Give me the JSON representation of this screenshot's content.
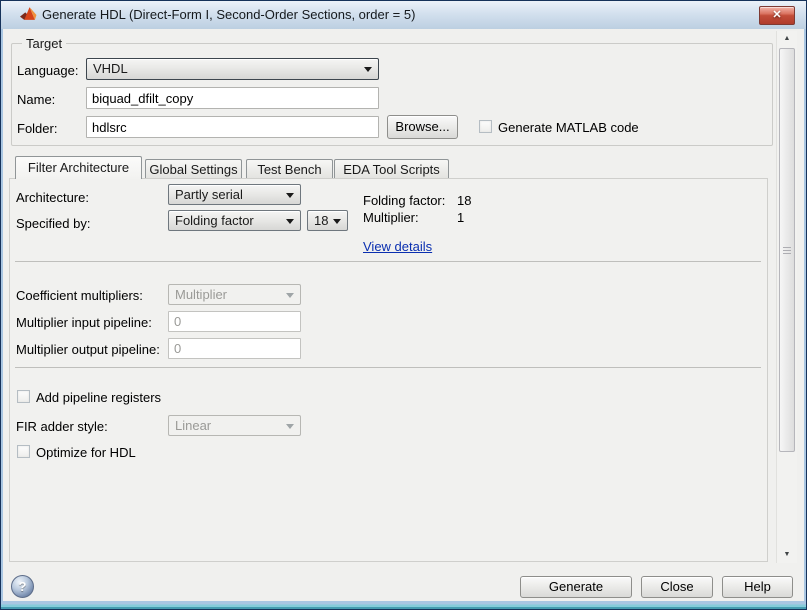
{
  "window": {
    "title": "Generate HDL (Direct-Form I, Second-Order Sections, order = 5)",
    "close_glyph": "✕",
    "app_icon": "matlab-logo"
  },
  "target": {
    "legend": "Target",
    "language_label": "Language:",
    "language_value": "VHDL",
    "name_label": "Name:",
    "name_value": "biquad_dfilt_copy",
    "folder_label": "Folder:",
    "folder_value": "hdlsrc",
    "browse_button": "Browse...",
    "generate_matlab_label": "Generate MATLAB code"
  },
  "tabs": {
    "items": [
      {
        "label": "Filter Architecture",
        "selected": true
      },
      {
        "label": "Global Settings",
        "selected": false
      },
      {
        "label": "Test Bench",
        "selected": false
      },
      {
        "label": "EDA Tool Scripts",
        "selected": false
      }
    ]
  },
  "filter_architecture": {
    "architecture_label": "Architecture:",
    "architecture_value": "Partly serial",
    "specified_by_label": "Specified by:",
    "specified_by_value": "Folding factor",
    "folding_select_value": "18",
    "folding_factor_label": "Folding factor:",
    "folding_factor_value": "18",
    "multiplier_label": "Multiplier:",
    "multiplier_value": "1",
    "view_details": "View details",
    "coefficient_multipliers_label": "Coefficient multipliers:",
    "coefficient_multipliers_value": "Multiplier",
    "multiplier_input_pipeline_label": "Multiplier input pipeline:",
    "multiplier_input_pipeline_value": "0",
    "multiplier_output_pipeline_label": "Multiplier output pipeline:",
    "multiplier_output_pipeline_value": "0",
    "add_pipeline_registers_label": "Add pipeline registers",
    "fir_adder_style_label": "FIR adder style:",
    "fir_adder_style_value": "Linear",
    "optimize_for_hdl_label": "Optimize for HDL"
  },
  "footer": {
    "help_glyph": "?",
    "generate_button": "Generate",
    "close_button": "Close",
    "help_button": "Help"
  },
  "scrollbar": {
    "up_glyph": "▲",
    "down_glyph": "▼"
  },
  "colors": {
    "frame": "#a9c6e2",
    "titlebar_top": "#ecf2f9",
    "close_red": "#c24d3a",
    "dialog_bg": "#f0f0ee",
    "link_blue": "#0a2fb0",
    "matlab_orange": "#d6431a"
  }
}
